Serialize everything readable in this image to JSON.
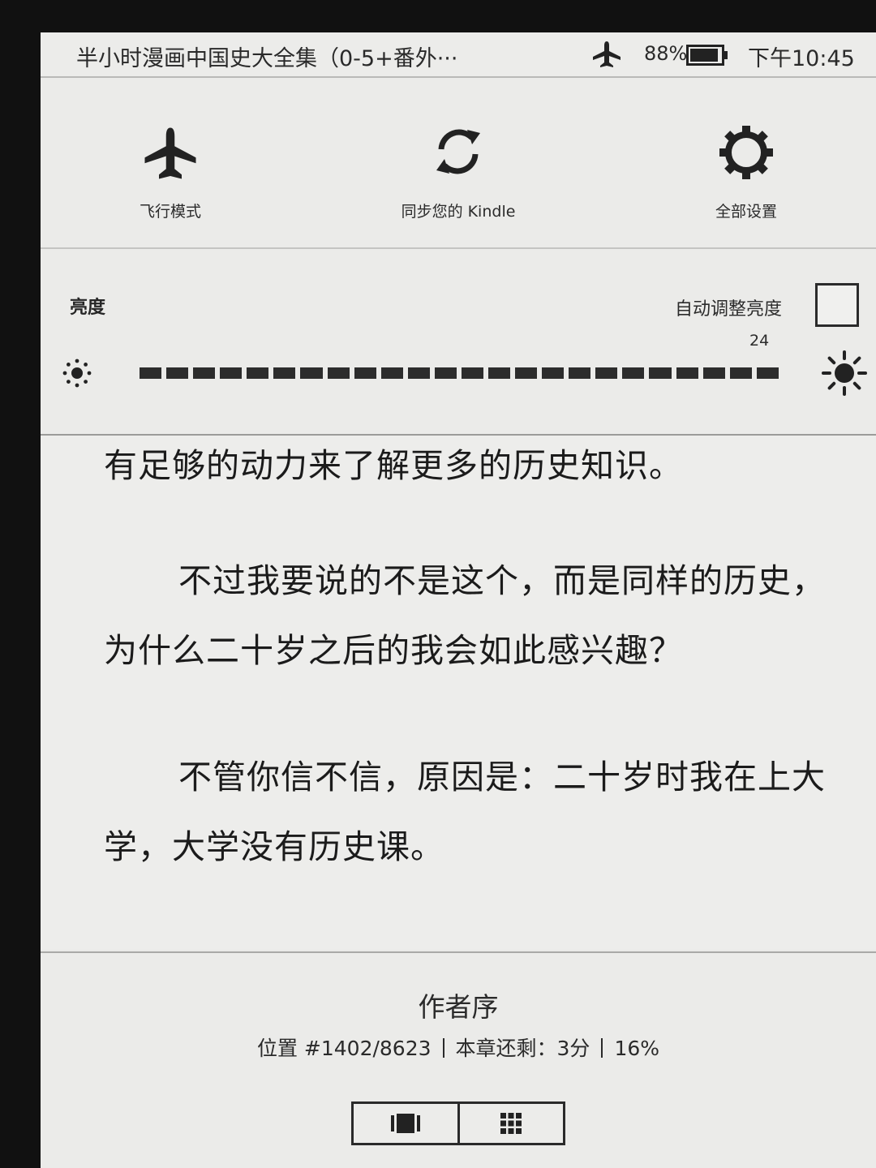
{
  "status_bar": {
    "book_title": "半小时漫画中国史大全集（0-5+番外···",
    "battery_percent": "88%",
    "time": "下午10:45",
    "icons": [
      "airplane-icon",
      "battery-icon"
    ]
  },
  "quick_actions": [
    {
      "label": "飞行模式",
      "icon": "airplane-icon"
    },
    {
      "label": "同步您的 Kindle",
      "icon": "sync-icon"
    },
    {
      "label": "全部设置",
      "icon": "gear-icon"
    }
  ],
  "brightness": {
    "label": "亮度",
    "auto_label": "自动调整亮度",
    "auto_checked": false,
    "value": "24",
    "level": 24,
    "max": 24
  },
  "reading": {
    "paragraphs": [
      "有足够的动力来了解更多的历史知识。",
      "不过我要说的不是这个，而是同样的历史，为什么二十岁之后的我会如此感兴趣？",
      "不管你信不信，原因是：二十岁时我在上大学，大学没有历史课。"
    ]
  },
  "footer": {
    "chapter": "作者序",
    "location": "位置 #1402/8623",
    "chapter_remaining": "本章还剩：3分",
    "percent": "16%",
    "buttons": [
      "page-flip-icon",
      "grid-view-icon"
    ]
  }
}
